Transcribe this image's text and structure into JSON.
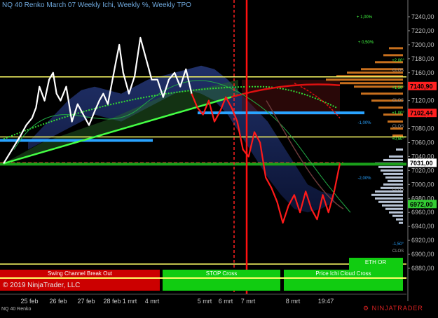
{
  "title": "NQ 40 Renko March 07 Weekly  Ichi,  Weekly %, Weekly TPO",
  "copyright": "© 2019 NinjaTrader, LLC",
  "instrument": "NQ 40 Renko",
  "brand": "NINJATRADER",
  "colors": {
    "background": "#000000",
    "price_line": "#ffffff",
    "down_line": "#ff1a1a",
    "ichi_cloud": "#1f2f66",
    "yellow_level": "#ffff66",
    "blue_level": "#29a3ff",
    "green_level": "#1aa01a",
    "tpo_up": "#c8701e",
    "tpo_down": "#b8c4d6"
  },
  "chart_data": {
    "type": "line",
    "title": "NQ 40 Renko March 07 Weekly  Ichi,  Weekly %, Weekly TPO",
    "xlabel": "",
    "ylabel": "",
    "x_tick_labels": [
      "25 feb",
      "26 feb",
      "27 feb",
      "28 feb",
      "1 mrt",
      "4 mrt",
      "5 mrt",
      "6 mrt",
      "7 mrt",
      "8 mrt",
      "19:47"
    ],
    "ylim": [
      6865,
      7250
    ],
    "y_ticks": [
      7240,
      7220,
      7200,
      7180,
      7160,
      7140,
      7120,
      7100,
      7080,
      7060,
      7040,
      7020,
      7000,
      6980,
      6960,
      6940,
      6920,
      6900,
      6880
    ],
    "y_tick_labels": [
      "7240,00",
      "7220,00",
      "7200,00",
      "7180,00",
      "7160,00",
      "7140,00",
      "7120,00",
      "7100,00",
      "7080,00",
      "7060,00",
      "7040,00",
      "7020,00",
      "7000,00",
      "6980,00",
      "6960,00",
      "6940,00",
      "6920,00",
      "6900,00",
      "6880,00"
    ],
    "price_labels": [
      {
        "value": 7140.9,
        "text": "7140,90",
        "color": "#ff2020"
      },
      {
        "value": 7102.44,
        "text": "7102,44",
        "color": "#ff2020"
      },
      {
        "value": 7031.0,
        "text": "7031,00",
        "color": "#ffffff"
      },
      {
        "value": 6972.0,
        "text": "6972,00",
        "color": "#33cc33"
      }
    ],
    "horizontal_levels": [
      {
        "value": 7154,
        "color": "#ffff66",
        "style": "solid"
      },
      {
        "value": 7068,
        "color": "#ffff66",
        "style": "solid"
      },
      {
        "value": 6886,
        "color": "#ffff66",
        "style": "solid"
      },
      {
        "value": 7102.44,
        "color": "#29a3ff",
        "style": "solid"
      },
      {
        "value": 7063,
        "color": "#29a3ff",
        "style": "solid"
      },
      {
        "value": 7031,
        "color": "#ff3333",
        "style": "dashed"
      },
      {
        "value": 7029,
        "color": "#1aa01a",
        "style": "solid"
      }
    ],
    "series": [
      {
        "name": "",
        "color": "#ffffff",
        "x": [
          0,
          1.5,
          3,
          4,
          5,
          5.7,
          6.3,
          7.2,
          8,
          8.7,
          9.3,
          10,
          11,
          12,
          13,
          14,
          15,
          16,
          16.8,
          17.5,
          18.3,
          19,
          19.7,
          20.3,
          21,
          22,
          23,
          24,
          25,
          26,
          27,
          28,
          29,
          30,
          31,
          32,
          33
        ],
        "values": [
          7030,
          7050,
          7070,
          7085,
          7095,
          7110,
          7140,
          7120,
          7150,
          7160,
          7130,
          7120,
          7140,
          7090,
          7115,
          7100,
          7085,
          7105,
          7120,
          7130,
          7115,
          7145,
          7175,
          7200,
          7160,
          7130,
          7155,
          7210,
          7180,
          7150,
          7150,
          7125,
          7150,
          7160,
          7140,
          7165,
          7130
        ]
      },
      {
        "name": "",
        "color": "#ff1a1a",
        "x": [
          33,
          34,
          35,
          36,
          37,
          38,
          39,
          40,
          41,
          42,
          43,
          44,
          45,
          46,
          47,
          48,
          49,
          50,
          51,
          52,
          53,
          54,
          55,
          56,
          57,
          58,
          59
        ],
        "values": [
          7130,
          7110,
          7100,
          7120,
          7090,
          7105,
          7125,
          7110,
          7090,
          7050,
          7040,
          7075,
          7060,
          7010,
          6995,
          6975,
          6945,
          6970,
          6985,
          6960,
          6990,
          6965,
          6950,
          6985,
          6960,
          6990,
          7030
        ]
      }
    ],
    "panel_labels": [
      "Swing Channel Break Out",
      "STOP Cross",
      "Price Ichi Cloud Cross",
      "ETH OR"
    ],
    "percent_labels": [
      "+ 1,00%",
      "+ 0,50%",
      "+2,00°",
      "+1,50°",
      "+1,00°",
      "+0,50°",
      "-1,00%",
      "-2,00%",
      "-1,50°"
    ],
    "tpo_labels": [
      "CLOS",
      "CLOS",
      "CLOS",
      "CLOS",
      "CLOS"
    ]
  }
}
